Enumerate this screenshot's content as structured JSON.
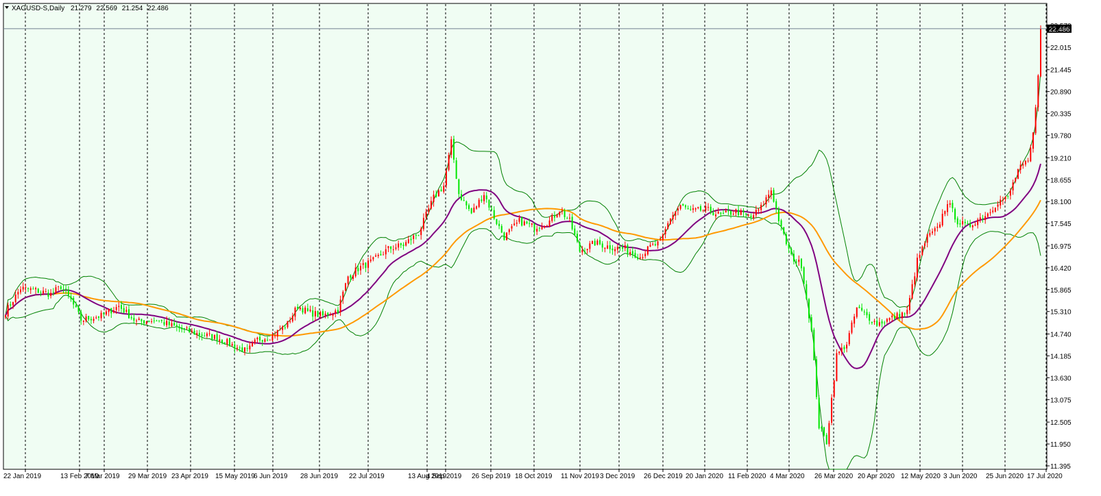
{
  "window": {
    "symbol_label": "XAGUSD-S,Daily",
    "ohlc": {
      "open": "21.279",
      "high": "22.569",
      "low": "21.254",
      "close": "22.486"
    },
    "collapse_icon": "triangle-down-icon",
    "current_price_label": "22.486"
  },
  "colors": {
    "background": "#f0fdf3",
    "bull_candle": "#ff0000",
    "bear_candle": "#00e600",
    "bollinger": "#008000",
    "ma_fast": "#800080",
    "ma_slow": "#ff9900",
    "grid": "#000000",
    "price_line": "#708090",
    "price_label_bg": "#000000",
    "price_label_fg": "#ffffff"
  },
  "chart_data": {
    "type": "candlestick",
    "title": "XAGUSD-S,Daily",
    "y_ticks": [
      "22.570",
      "22.015",
      "21.445",
      "20.890",
      "20.335",
      "19.780",
      "19.210",
      "18.655",
      "18.100",
      "17.545",
      "16.975",
      "16.420",
      "15.865",
      "15.310",
      "14.740",
      "14.185",
      "13.630",
      "13.075",
      "12.505",
      "11.950",
      "11.395"
    ],
    "ylim": [
      11.395,
      22.57
    ],
    "x_ticks": [
      "22 Jan 2019",
      "13 Feb 2019",
      "7 Mar 2019",
      "29 Mar 2019",
      "23 Apr 2019",
      "15 May 2019",
      "6 Jun 2019",
      "28 Jun 2019",
      "22 Jul 2019",
      "13 Aug 2019",
      "4 Sep 2019",
      "26 Sep 2019",
      "18 Oct 2019",
      "11 Nov 2019",
      "3 Dec 2019",
      "26 Dec 2019",
      "20 Jan 2020",
      "11 Feb 2020",
      "4 Mar 2020",
      "26 Mar 2020",
      "20 Apr 2020",
      "12 May 2020",
      "3 Jun 2020",
      "25 Jun 2020",
      "17 Jul 2020"
    ],
    "close_keypoints": [
      [
        0,
        15.3
      ],
      [
        6,
        15.9
      ],
      [
        12,
        15.85
      ],
      [
        18,
        15.75
      ],
      [
        22,
        15.95
      ],
      [
        26,
        15.6
      ],
      [
        30,
        15.1
      ],
      [
        38,
        15.2
      ],
      [
        45,
        15.45
      ],
      [
        52,
        15.05
      ],
      [
        60,
        15.1
      ],
      [
        68,
        14.9
      ],
      [
        76,
        14.75
      ],
      [
        84,
        14.65
      ],
      [
        92,
        14.4
      ],
      [
        96,
        14.3
      ],
      [
        100,
        14.6
      ],
      [
        106,
        14.7
      ],
      [
        112,
        15.0
      ],
      [
        116,
        15.45
      ],
      [
        120,
        15.3
      ],
      [
        126,
        15.2
      ],
      [
        132,
        15.35
      ],
      [
        136,
        16.2
      ],
      [
        140,
        16.4
      ],
      [
        146,
        16.6
      ],
      [
        152,
        16.9
      ],
      [
        158,
        17.0
      ],
      [
        164,
        17.3
      ],
      [
        170,
        18.2
      ],
      [
        174,
        18.5
      ],
      [
        177,
        19.6
      ],
      [
        180,
        18.3
      ],
      [
        185,
        17.8
      ],
      [
        190,
        18.3
      ],
      [
        194,
        17.7
      ],
      [
        198,
        17.2
      ],
      [
        204,
        17.6
      ],
      [
        210,
        17.45
      ],
      [
        216,
        17.6
      ],
      [
        220,
        17.9
      ],
      [
        224,
        17.6
      ],
      [
        228,
        16.85
      ],
      [
        234,
        17.05
      ],
      [
        240,
        16.95
      ],
      [
        246,
        16.9
      ],
      [
        252,
        16.7
      ],
      [
        256,
        16.95
      ],
      [
        260,
        17.05
      ],
      [
        264,
        17.7
      ],
      [
        268,
        18.0
      ],
      [
        272,
        17.85
      ],
      [
        278,
        17.9
      ],
      [
        284,
        17.75
      ],
      [
        290,
        17.85
      ],
      [
        296,
        17.7
      ],
      [
        300,
        17.95
      ],
      [
        304,
        18.4
      ],
      [
        308,
        17.4
      ],
      [
        312,
        16.7
      ],
      [
        316,
        16.5
      ],
      [
        320,
        14.8
      ],
      [
        323,
        12.4
      ],
      [
        326,
        12.0
      ],
      [
        330,
        14.2
      ],
      [
        334,
        14.5
      ],
      [
        338,
        15.4
      ],
      [
        342,
        15.2
      ],
      [
        346,
        15.0
      ],
      [
        350,
        15.1
      ],
      [
        354,
        15.2
      ],
      [
        358,
        15.3
      ],
      [
        362,
        16.6
      ],
      [
        366,
        17.2
      ],
      [
        370,
        17.4
      ],
      [
        374,
        18.1
      ],
      [
        378,
        17.6
      ],
      [
        382,
        17.45
      ],
      [
        386,
        17.65
      ],
      [
        390,
        17.8
      ],
      [
        394,
        18.1
      ],
      [
        398,
        18.2
      ],
      [
        402,
        18.9
      ],
      [
        406,
        19.1
      ],
      [
        408,
        19.8
      ],
      [
        410,
        21.3
      ],
      [
        411,
        22.486
      ]
    ]
  }
}
